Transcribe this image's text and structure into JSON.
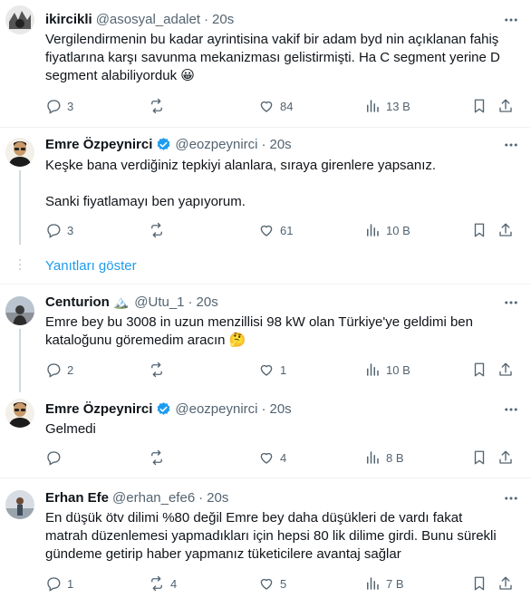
{
  "tweets": [
    {
      "name": "ikircikli",
      "handle": "@asosyal_adalet",
      "time": "20s",
      "lines": [
        "Vergilendirmenin bu kadar ayrintisina vakif bir adam byd nin açıklanan fahiş",
        "fiyatlarına karşı savunma mekanizması gelistirmişti. Ha C segment yerine D",
        "segment alabiliyorduk 😀"
      ],
      "replies": "3",
      "reposts": "",
      "likes": "84",
      "views": "13 B"
    },
    {
      "name": "Emre Özpeynirci",
      "handle": "@eozpeynirci",
      "time": "20s",
      "lines": [
        "Keşke bana verdiğiniz tepkiyi alanlara, sıraya girenlere yapsanız.",
        "",
        "Sanki fiyatlamayı ben yapıyorum."
      ],
      "replies": "3",
      "reposts": "",
      "likes": "61",
      "views": "10 B"
    },
    {
      "name": "Centurion",
      "name_emoji": "🏔️",
      "handle": "@Utu_1",
      "time": "20s",
      "lines": [
        "Emre bey bu 3008 in uzun menzillisi 98 kW olan Türkiye'ye geldimi ben",
        "kataloğunu göremedim aracın 🤔"
      ],
      "replies": "2",
      "reposts": "",
      "likes": "1",
      "views": "10 B"
    },
    {
      "name": "Emre Özpeynirci",
      "handle": "@eozpeynirci",
      "time": "20s",
      "lines": [
        "Gelmedi"
      ],
      "replies": "",
      "reposts": "",
      "likes": "4",
      "views": "8 B"
    },
    {
      "name": "Erhan Efe",
      "handle": "@erhan_efe6",
      "time": "20s",
      "lines": [
        "En düşük ötv dilimi %80 değil Emre bey daha düşükleri de vardı fakat",
        "matrah düzenlemesi yapmadıkları için hepsi 80 lik dilime girdi. Bunu sürekli",
        "gündeme getirip haber yapmanız tüketicilere avantaj sağlar"
      ],
      "replies": "1",
      "reposts": "4",
      "likes": "5",
      "views": "7 B"
    }
  ],
  "show_replies_label": "Yanıtları göster",
  "colors": {
    "text": "#0f1419",
    "secondary": "#536471",
    "accent": "#1d9bf0",
    "divider": "#eff3f4"
  }
}
